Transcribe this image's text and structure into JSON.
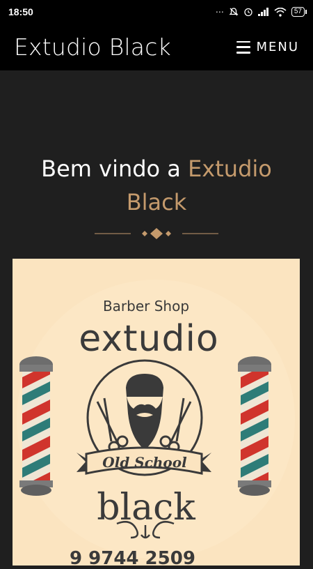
{
  "status_bar": {
    "time": "18:50",
    "battery": "57",
    "icons": [
      "mute-icon",
      "bell-off-icon",
      "alarm-icon",
      "signal-icon",
      "wifi-icon",
      "battery-icon"
    ]
  },
  "header": {
    "brand": "Extudio Black",
    "menu_label": "MENU"
  },
  "welcome": {
    "prefix": "Bem vindo a ",
    "accent_line1": "Extudio",
    "accent_line2": "Black"
  },
  "logo": {
    "tagline": "Barber Shop",
    "word_top": "extudio",
    "ribbon": "Old School",
    "word_bottom": "black"
  },
  "phone_partial": "9 9744 2509",
  "colors": {
    "accent": "#c49a6c",
    "header_bg": "#000000",
    "page_bg": "#1f1f1f",
    "card_bg": "#fbe4c0",
    "ink": "#3a3a3a"
  }
}
